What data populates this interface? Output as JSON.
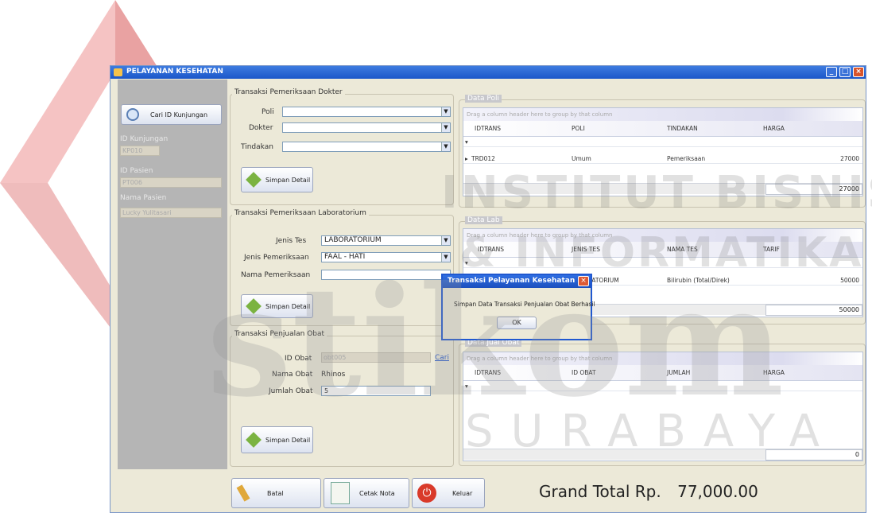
{
  "window": {
    "title": "PELAYANAN KESEHATAN"
  },
  "left": {
    "search_button": "Cari ID Kunjungan",
    "id_kunjungan_label": "ID Kunjungan",
    "id_kunjungan_value": "KP010",
    "id_pasien_label": "ID Pasien",
    "id_pasien_value": "PT006",
    "nama_pasien_label": "Nama Pasien",
    "nama_pasien_value": "Lucky Yulitasari"
  },
  "dokter": {
    "group_title": "Transaksi Pemeriksaan Dokter",
    "poli_label": "Poli",
    "dokter_label": "Dokter",
    "tindakan_label": "Tindakan",
    "save_button": "Simpan Detail"
  },
  "lab": {
    "group_title": "Transaksi Pemeriksaan Laboratorium",
    "jenis_tes_label": "Jenis Tes",
    "jenis_tes_value": "LABORATORIUM",
    "jenis_pemeriksaan_label": "Jenis Pemeriksaan",
    "jenis_pemeriksaan_value": "FAAL - HATI",
    "nama_pemeriksaan_label": "Nama Pemeriksaan",
    "save_button": "Simpan Detail"
  },
  "obat": {
    "group_title": "Transaksi Penjualan Obat",
    "id_obat_label": "ID Obat",
    "id_obat_value": "obt005",
    "cari_link": "Cari",
    "nama_obat_label": "Nama Obat",
    "nama_obat_value": "Rhinos",
    "jumlah_label": "Jumlah Obat",
    "jumlah_value": "5",
    "save_button": "Simpan Detail"
  },
  "grid_poli": {
    "title": "Data Poli",
    "group_hint": "Drag a column header here to group by that column",
    "columns": [
      "IDTRANS",
      "POLI",
      "TINDAKAN",
      "HARGA"
    ],
    "rows": [
      [
        "TRD012",
        "Umum",
        "Pemeriksaan",
        "27000"
      ]
    ],
    "total": "27000"
  },
  "grid_lab": {
    "title": "Data Lab",
    "group_hint": "Drag a column header here to group by that column",
    "columns": [
      "IDTRANS",
      "JENIS TES",
      "NAMA TES",
      "TARIF"
    ],
    "rows": [
      [
        "",
        "LABORATORIUM",
        "Bilirubin (Total/Direk)",
        "50000"
      ]
    ],
    "total": "50000"
  },
  "grid_obat": {
    "title": "Data Jual Obat",
    "group_hint": "Drag a column header here to group by that column",
    "columns": [
      "IDTRANS",
      "ID OBAT",
      "JUMLAH",
      "HARGA"
    ],
    "total": "0"
  },
  "dialog": {
    "title": "Transaksi Pelayanan Kesehatan",
    "message": "Simpan Data Transaksi Penjualan Obat Berhasil",
    "ok": "OK"
  },
  "bottom": {
    "batal": "Batal",
    "cetak": "Cetak Nota",
    "keluar": "Keluar",
    "grand_total_label": "Grand Total Rp.",
    "grand_total_value": "77,000.00"
  },
  "watermark": {
    "line1": "INSTITUT BISNIS",
    "line2": "& INFORMATIKA",
    "logo": "stikom",
    "line3": "SURABAYA"
  },
  "colors": {
    "title_bar": "#1b57c9",
    "logo_red": "#d6332f",
    "window_bg": "#ece9d8"
  }
}
